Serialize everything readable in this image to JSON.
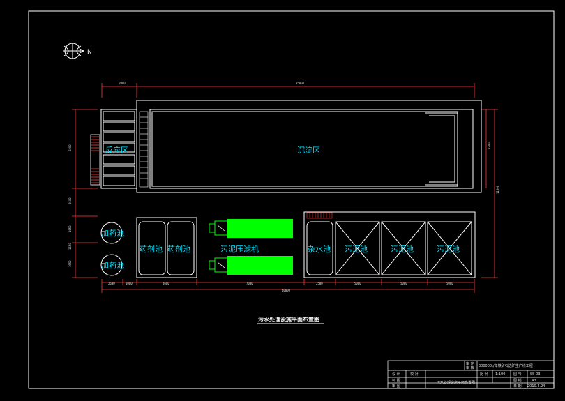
{
  "drawing": {
    "north_label": "N",
    "title": "污水处理设施平面布置图",
    "colors": {
      "background": "#000000",
      "lines": "#ffffff",
      "labels": "#00e5ff",
      "press": "#00ff00",
      "red": "#ff3b3b"
    }
  },
  "areas": {
    "reverse": "反应区",
    "settle": "沉淀区",
    "dose1": "加药池",
    "dose2": "加药池",
    "reagent1": "药剂池",
    "reagent2": "药剂池",
    "press": "污泥压滤机",
    "misc": "杂水池",
    "sludge1": "污泥池",
    "sludge2": "污泥池",
    "sludge3": "污泥池"
  },
  "dimensions": {
    "top_small": "5900",
    "top_big": "35000",
    "left_upper": "8200",
    "left_mid": "3500",
    "left_low1": "1650",
    "left_low2": "1650",
    "left_low3": "1650",
    "right_side": "11000",
    "right_upper": "8200",
    "bottom": [
      "2600",
      "1000",
      "4600",
      "7000",
      "2500",
      "5000",
      "5000",
      "5000"
    ],
    "bottom_total": "40000"
  },
  "title_block": {
    "project": "300000t/年铁矿石选矿生产线工程",
    "drawing_name": "污水处理设施平面布置图",
    "scale_label": "比 例",
    "scale": "1:100",
    "number_label": "图 号",
    "number": "SS-03",
    "size_label": "图 幅",
    "size": "A3",
    "date_label": "日 期",
    "date": "2010.4.24",
    "role1": "审 定",
    "role2": "审 核",
    "role3": "设 计",
    "role4": "校 对",
    "role5": "制 图",
    "role6": "审 图"
  }
}
